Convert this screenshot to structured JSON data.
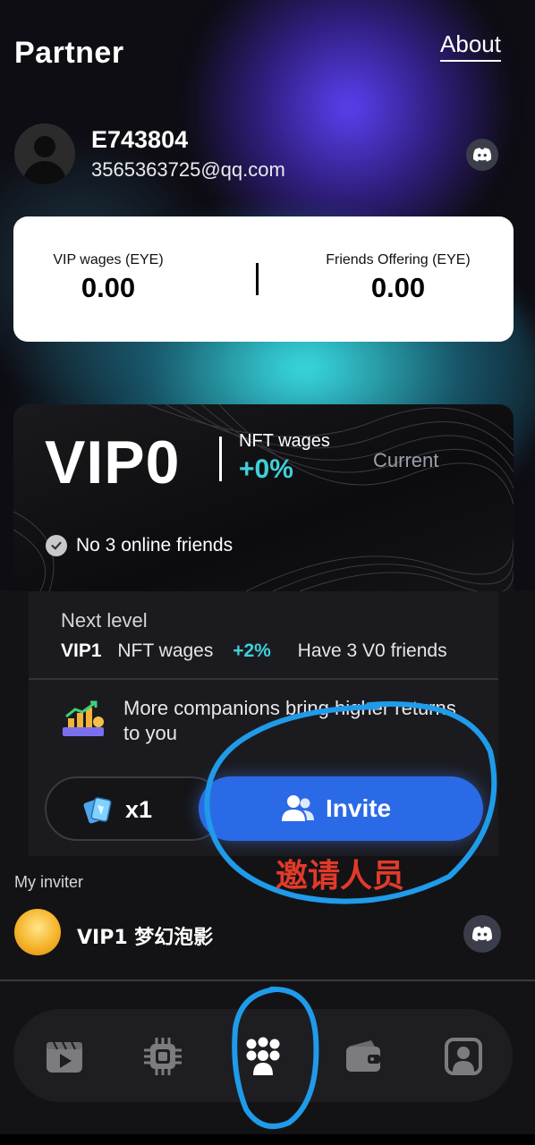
{
  "header": {
    "title": "Partner",
    "about_label": "About"
  },
  "profile": {
    "user_id": "E743804",
    "email": "3565363725@qq.com"
  },
  "stats": {
    "vip_wages_label": "VIP wages (EYE)",
    "vip_wages_value": "0.00",
    "friends_offering_label": "Friends Offering (EYE)",
    "friends_offering_value": "0.00"
  },
  "vip_card": {
    "level": "VIP0",
    "nft_wages_label": "NFT wages",
    "nft_wages_pct": "+0%",
    "status": "Current",
    "condition": "No 3 online friends"
  },
  "next_level": {
    "title": "Next level",
    "level": "VIP1",
    "nft_wages_label": "NFT wages",
    "nft_wages_pct": "+2%",
    "requirement": "Have 3 V0 friends",
    "promo_text": "More companions bring higher returns to you"
  },
  "actions": {
    "card_count": "x1",
    "invite_label": "Invite"
  },
  "annotation": {
    "text": "邀请人员",
    "color": "#e23a2a",
    "circle_color": "#1f9bea"
  },
  "inviter": {
    "section_label": "My inviter",
    "name": "VIP1 梦幻泡影"
  },
  "colors": {
    "accent_teal": "#3fd0d9",
    "invite_blue": "#2b6ae6"
  },
  "nav": {
    "items": [
      {
        "icon": "video-icon"
      },
      {
        "icon": "chip-icon"
      },
      {
        "icon": "partner-icon"
      },
      {
        "icon": "wallet-icon"
      },
      {
        "icon": "profile-icon"
      }
    ]
  }
}
